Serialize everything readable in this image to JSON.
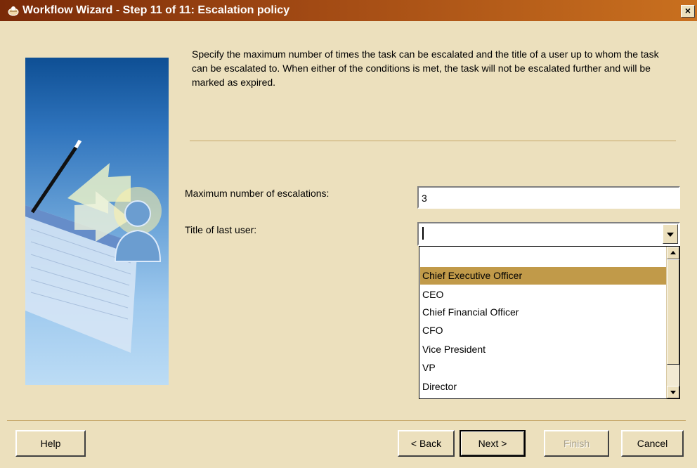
{
  "window": {
    "title": "Workflow Wizard - Step 11 of 11: Escalation policy",
    "close_label": "×"
  },
  "description": "Specify the maximum number of times the task can be escalated and the title of a user up to whom the task can be escalated to. When either of the conditions is met, the task will not be escalated further and will be marked as expired.",
  "form": {
    "max_escalations_label": "Maximum number of escalations:",
    "max_escalations_value": "3",
    "title_last_user_label": "Title of last user:",
    "title_last_user_value": ""
  },
  "dropdown": {
    "options": [
      "",
      "Chief Executive Officer",
      "CEO",
      "Chief Financial Officer",
      "CFO",
      "Vice President",
      "VP",
      "Director"
    ],
    "selected": "Chief Executive Officer"
  },
  "buttons": {
    "help": "Help",
    "back": "< Back",
    "next": "Next >",
    "finish": "Finish",
    "cancel": "Cancel"
  },
  "colors": {
    "dialog_bg": "#ece0bd",
    "titlebar_start": "#7a2a08",
    "titlebar_end": "#c9701f",
    "selection": "#c19a49"
  }
}
